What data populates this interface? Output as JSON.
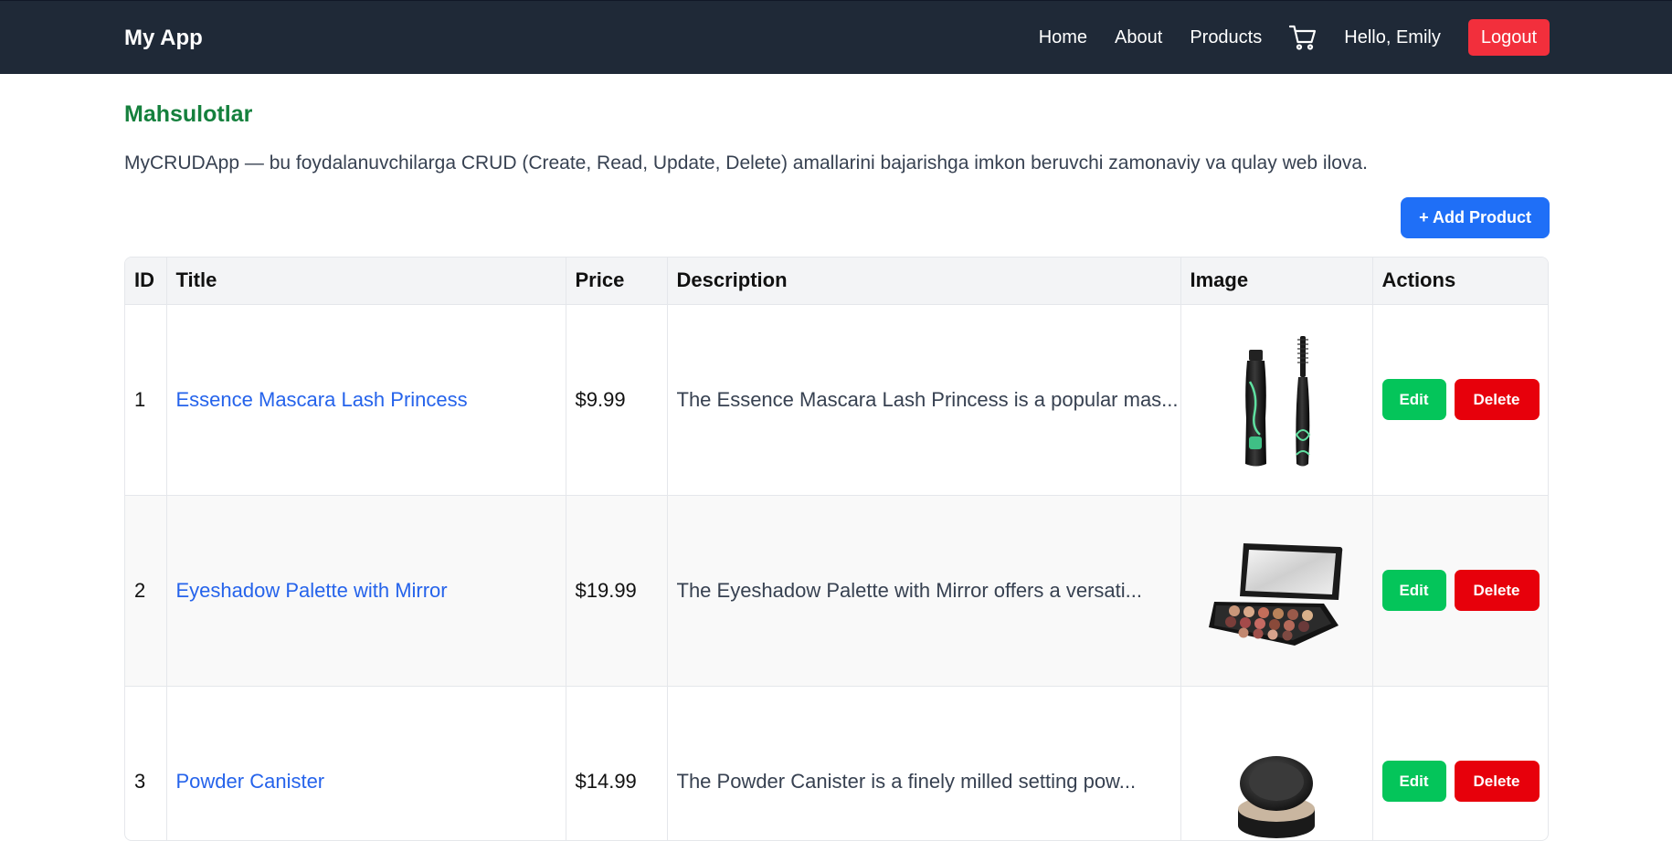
{
  "navbar": {
    "brand": "My App",
    "links": [
      "Home",
      "About",
      "Products"
    ],
    "cart_icon": "cart-icon",
    "greeting": "Hello, Emily",
    "logout_label": "Logout"
  },
  "page": {
    "title": "Mahsulotlar",
    "intro": "MyCRUDApp — bu foydalanuvchilarga CRUD (Create, Read, Update, Delete) amallarini bajarishga imkon beruvchi zamonaviy va qulay web ilova.",
    "add_label": "+ Add Product"
  },
  "table": {
    "headers": [
      "ID",
      "Title",
      "Price",
      "Description",
      "Image",
      "Actions"
    ],
    "rows": [
      {
        "id": "1",
        "title": "Essence Mascara Lash Princess",
        "price": "$9.99",
        "description": "The Essence Mascara Lash Princess is a popular mas...",
        "image": "mascara-image",
        "edit_label": "Edit",
        "delete_label": "Delete"
      },
      {
        "id": "2",
        "title": "Eyeshadow Palette with Mirror",
        "price": "$19.99",
        "description": "The Eyeshadow Palette with Mirror offers a versati...",
        "image": "eyeshadow-palette-image",
        "edit_label": "Edit",
        "delete_label": "Delete"
      },
      {
        "id": "3",
        "title": "Powder Canister",
        "price": "$14.99",
        "description": "The Powder Canister is a finely milled setting pow...",
        "image": "powder-canister-image",
        "edit_label": "Edit",
        "delete_label": "Delete"
      }
    ]
  },
  "colors": {
    "navbar_bg": "#1f2937",
    "title_green": "#15803d",
    "link_blue": "#2563eb",
    "primary_blue": "#1f6ff7",
    "edit_green": "#04c55a",
    "delete_red": "#e7000b",
    "logout_red": "#f22f3c"
  }
}
